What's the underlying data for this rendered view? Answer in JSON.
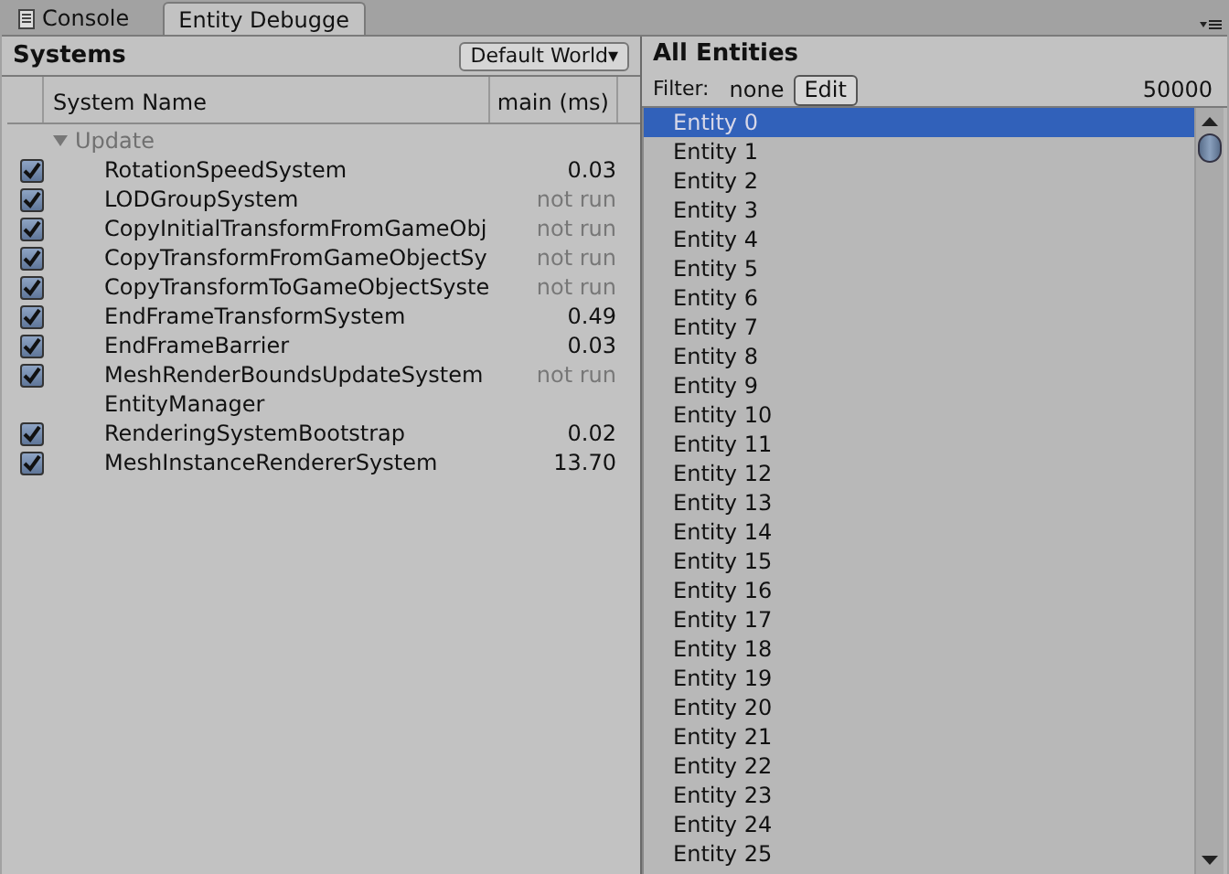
{
  "tabs": [
    {
      "label": "Console",
      "kind": "console",
      "selected": false
    },
    {
      "label": "Entity Debugge",
      "kind": "plain",
      "selected": true
    }
  ],
  "systems_panel": {
    "title": "Systems",
    "world_dropdown": "Default World▾",
    "columns": [
      "System Name",
      "main (ms)"
    ],
    "groups": [
      {
        "label": "Update",
        "expanded": true,
        "children": [
          {
            "kind": "system",
            "name": "RotationSpeedSystem",
            "checked": true,
            "time": "0.03",
            "ran": true
          },
          {
            "kind": "system",
            "name": "LODGroupSystem",
            "checked": true,
            "time": "not run",
            "ran": false
          },
          {
            "kind": "system",
            "name": "CopyInitialTransformFromGameObj",
            "checked": true,
            "time": "not run",
            "ran": false
          },
          {
            "kind": "system",
            "name": "CopyTransformFromGameObjectSy",
            "checked": true,
            "time": "not run",
            "ran": false
          },
          {
            "kind": "system",
            "name": "CopyTransformToGameObjectSyste",
            "checked": true,
            "time": "not run",
            "ran": false
          },
          {
            "kind": "system",
            "name": "EndFrameTransformSystem",
            "checked": true,
            "time": "0.49",
            "ran": true
          },
          {
            "kind": "system",
            "name": "EndFrameBarrier",
            "checked": true,
            "time": "0.03",
            "ran": true
          },
          {
            "kind": "system",
            "name": "MeshRenderBoundsUpdateSystem",
            "checked": true,
            "time": "not run",
            "ran": false
          },
          {
            "kind": "manager",
            "name": "EntityManager"
          },
          {
            "kind": "system",
            "name": "RenderingSystemBootstrap",
            "checked": true,
            "time": "0.02",
            "ran": true
          },
          {
            "kind": "system",
            "name": "MeshInstanceRendererSystem",
            "checked": true,
            "time": "13.70",
            "ran": true
          }
        ]
      }
    ]
  },
  "entities_panel": {
    "title": "All Entities",
    "filter_label": "Filter:",
    "filter_value": "none",
    "edit_button": "Edit",
    "count": "50000",
    "entities": [
      {
        "label": "Entity 0",
        "selected": true
      },
      {
        "label": "Entity 1",
        "selected": false
      },
      {
        "label": "Entity 2",
        "selected": false
      },
      {
        "label": "Entity 3",
        "selected": false
      },
      {
        "label": "Entity 4",
        "selected": false
      },
      {
        "label": "Entity 5",
        "selected": false
      },
      {
        "label": "Entity 6",
        "selected": false
      },
      {
        "label": "Entity 7",
        "selected": false
      },
      {
        "label": "Entity 8",
        "selected": false
      },
      {
        "label": "Entity 9",
        "selected": false
      },
      {
        "label": "Entity 10",
        "selected": false
      },
      {
        "label": "Entity 11",
        "selected": false
      },
      {
        "label": "Entity 12",
        "selected": false
      },
      {
        "label": "Entity 13",
        "selected": false
      },
      {
        "label": "Entity 14",
        "selected": false
      },
      {
        "label": "Entity 15",
        "selected": false
      },
      {
        "label": "Entity 16",
        "selected": false
      },
      {
        "label": "Entity 17",
        "selected": false
      },
      {
        "label": "Entity 18",
        "selected": false
      },
      {
        "label": "Entity 19",
        "selected": false
      },
      {
        "label": "Entity 20",
        "selected": false
      },
      {
        "label": "Entity 21",
        "selected": false
      },
      {
        "label": "Entity 22",
        "selected": false
      },
      {
        "label": "Entity 23",
        "selected": false
      },
      {
        "label": "Entity 24",
        "selected": false
      },
      {
        "label": "Entity 25",
        "selected": false
      }
    ]
  }
}
